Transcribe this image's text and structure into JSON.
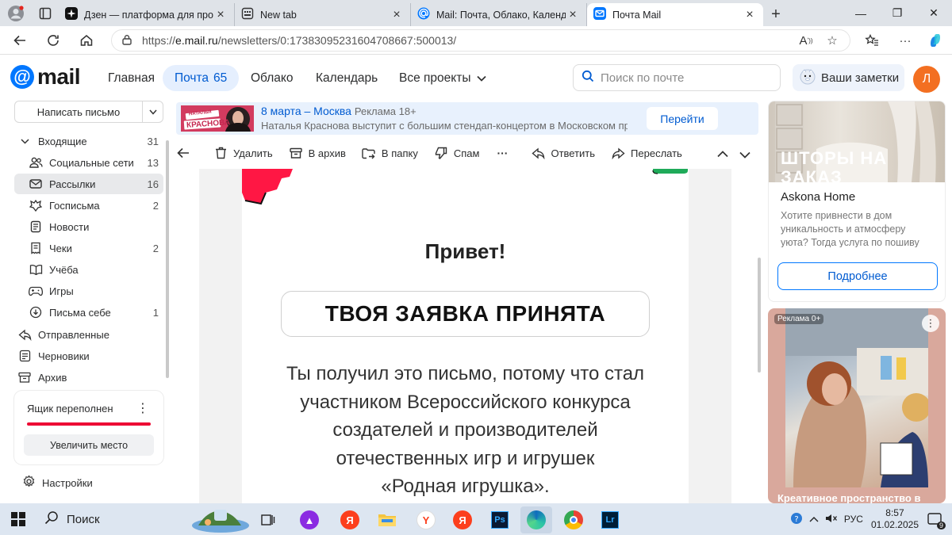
{
  "browser": {
    "tabs": [
      {
        "label": "Дзен — платформа для просмотра",
        "icon": "zen-icon"
      },
      {
        "label": "New tab",
        "icon": "newtab-icon"
      },
      {
        "label": "Mail: Почта, Облако, Календарь,",
        "icon": "mail-icon"
      },
      {
        "label": "Почта Mail",
        "icon": "mail-icon",
        "active": true
      }
    ],
    "url_prefix": "https://",
    "url_host": "e.mail.ru",
    "url_path": "/newsletters/0:17383095231604708667:500013/"
  },
  "mail": {
    "logo": "mail",
    "nav": [
      {
        "label": "Главная"
      },
      {
        "label": "Почта",
        "count": "65",
        "active": true
      },
      {
        "label": "Облако"
      },
      {
        "label": "Календарь"
      },
      {
        "label": "Все проекты"
      }
    ],
    "search_placeholder": "Поиск по почте",
    "notes_label": "Ваши заметки",
    "avatar_letter": "Л",
    "accent": "#0077ff"
  },
  "sidebar": {
    "compose": "Написать письмо",
    "inbox": {
      "label": "Входящие",
      "count": "31"
    },
    "folders": [
      {
        "label": "Социальные сети",
        "count": "13",
        "icon": "people-icon"
      },
      {
        "label": "Рассылки",
        "count": "16",
        "icon": "newsletter-icon",
        "active": true
      },
      {
        "label": "Госписьма",
        "count": "2",
        "icon": "emblem-icon"
      },
      {
        "label": "Новости",
        "count": "",
        "icon": "news-icon"
      },
      {
        "label": "Чеки",
        "count": "2",
        "icon": "receipt-icon"
      },
      {
        "label": "Учёба",
        "count": "",
        "icon": "book-icon"
      },
      {
        "label": "Игры",
        "count": "",
        "icon": "gamepad-icon"
      },
      {
        "label": "Письма себе",
        "count": "1",
        "icon": "self-mail-icon"
      }
    ],
    "top_folders": [
      {
        "label": "Отправленные",
        "icon": "sent-icon"
      },
      {
        "label": "Черновики",
        "icon": "drafts-icon"
      },
      {
        "label": "Архив",
        "icon": "archive-icon"
      }
    ],
    "full_box": {
      "title": "Ящик переполнен",
      "button": "Увеличить место",
      "fill": 1.0
    },
    "settings": "Настройки"
  },
  "ad_banner": {
    "title": "8 марта – Москва",
    "tag": "Реклама 18+",
    "text": "Наталья Краснова выступит с большим стендап-концертом в Московском про…",
    "button": "Перейти",
    "image_caption_small": "НАТАЛЬЯ",
    "image_caption": "КРАСНОВА"
  },
  "toolbar": {
    "delete": "Удалить",
    "archive": "В архив",
    "to_folder": "В папку",
    "spam": "Спам",
    "reply": "Ответить",
    "forward": "Переслать"
  },
  "letter": {
    "greeting": "Привет!",
    "headline": "ТВОЯ ЗАЯВКА ПРИНЯТА",
    "body_lines": [
      "Ты получил это письмо, потому что стал",
      "участником Всероссийского конкурса",
      "создателей и производителей",
      "отечественных игр и игрушек",
      "«Родная игрушка»."
    ]
  },
  "right_ads": {
    "ad1": {
      "image_text": "ШТОРЫ НА ЗАКАЗ",
      "name": "Askona Home",
      "desc": "Хотите привнести в дом уникальность и атмосферу уюта? Тогда услуга по пошиву штор на заказ",
      "button": "Подробнее"
    },
    "ad2": {
      "label": "Реклама 0+",
      "caption": "Креативное пространство в"
    }
  },
  "taskbar": {
    "search": "Поиск",
    "lang": "РУС",
    "time": "8:57",
    "date": "01.02.2025",
    "notifications": "9"
  }
}
